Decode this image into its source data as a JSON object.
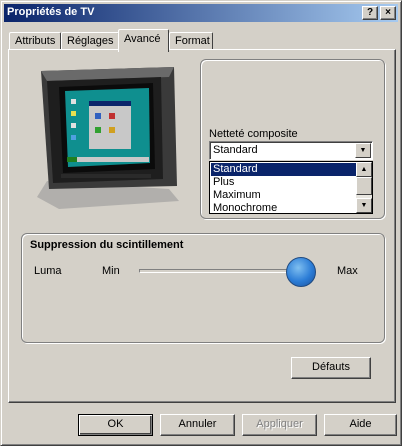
{
  "window": {
    "title": "Propriétés de TV",
    "help_button": "?",
    "close_button": "×"
  },
  "tabs": [
    {
      "label": "Attributs"
    },
    {
      "label": "Réglages"
    },
    {
      "label": "Avancé"
    },
    {
      "label": "Format"
    }
  ],
  "active_tab": "Avancé",
  "sharpness": {
    "label": "Netteté composite",
    "selected": "Standard",
    "options": [
      "Standard",
      "Plus",
      "Maximum",
      "Monochrome"
    ]
  },
  "flicker": {
    "title": "Suppression du scintillement",
    "channel_label": "Luma",
    "min_label": "Min",
    "max_label": "Max",
    "level": 1.0
  },
  "defaults_button": "Défauts",
  "footer": {
    "ok": "OK",
    "cancel": "Annuler",
    "apply": "Appliquer",
    "help": "Aide"
  }
}
